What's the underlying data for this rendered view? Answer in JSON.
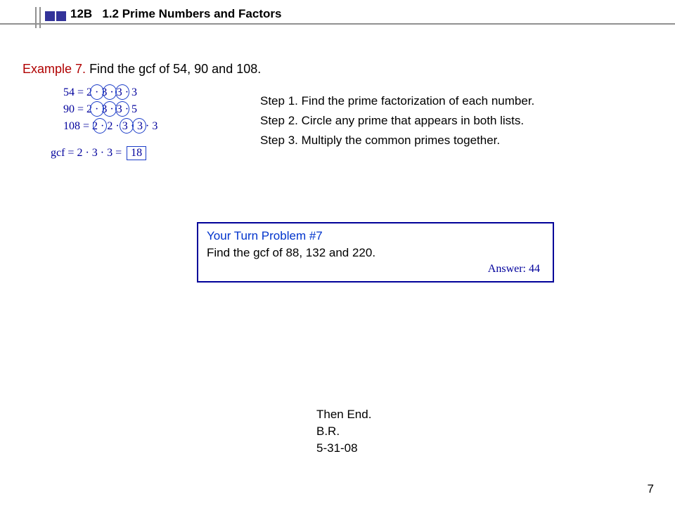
{
  "header": {
    "code": "12B",
    "title": "1.2  Prime Numbers and Factors"
  },
  "example": {
    "label": "Example 7.",
    "prompt": "Find the gcf of 54, 90 and 108."
  },
  "factorizations": {
    "r1_lhs": "54  =",
    "r1_a": "2",
    "r1_b": "3",
    "r1_c": "3",
    "r1_d": "3",
    "r2_lhs": "90  =",
    "r2_a": "2",
    "r2_b": "3",
    "r2_c": "3",
    "r2_d": "5",
    "r3_lhs": "108 =",
    "r3_a": "2",
    "r3_b": "2",
    "r3_c": "3",
    "r3_d": "3",
    "r3_e": "3"
  },
  "gcf": {
    "expr": "gcf = 2 · 3 · 3 =",
    "result": "18"
  },
  "steps": {
    "s1": "Step 1.  Find the prime factorization of each number.",
    "s2": "Step 2.  Circle any prime that appears in both lists.",
    "s3": "Step 3.  Multiply the common primes together."
  },
  "turn": {
    "title": "Your Turn Problem #7",
    "problem": "Find the gcf of 88, 132 and 220.",
    "answer": "Answer:  44"
  },
  "endnote": {
    "l1": "Then End.",
    "l2": "B.R.",
    "l3": "5-31-08"
  },
  "page": "7"
}
